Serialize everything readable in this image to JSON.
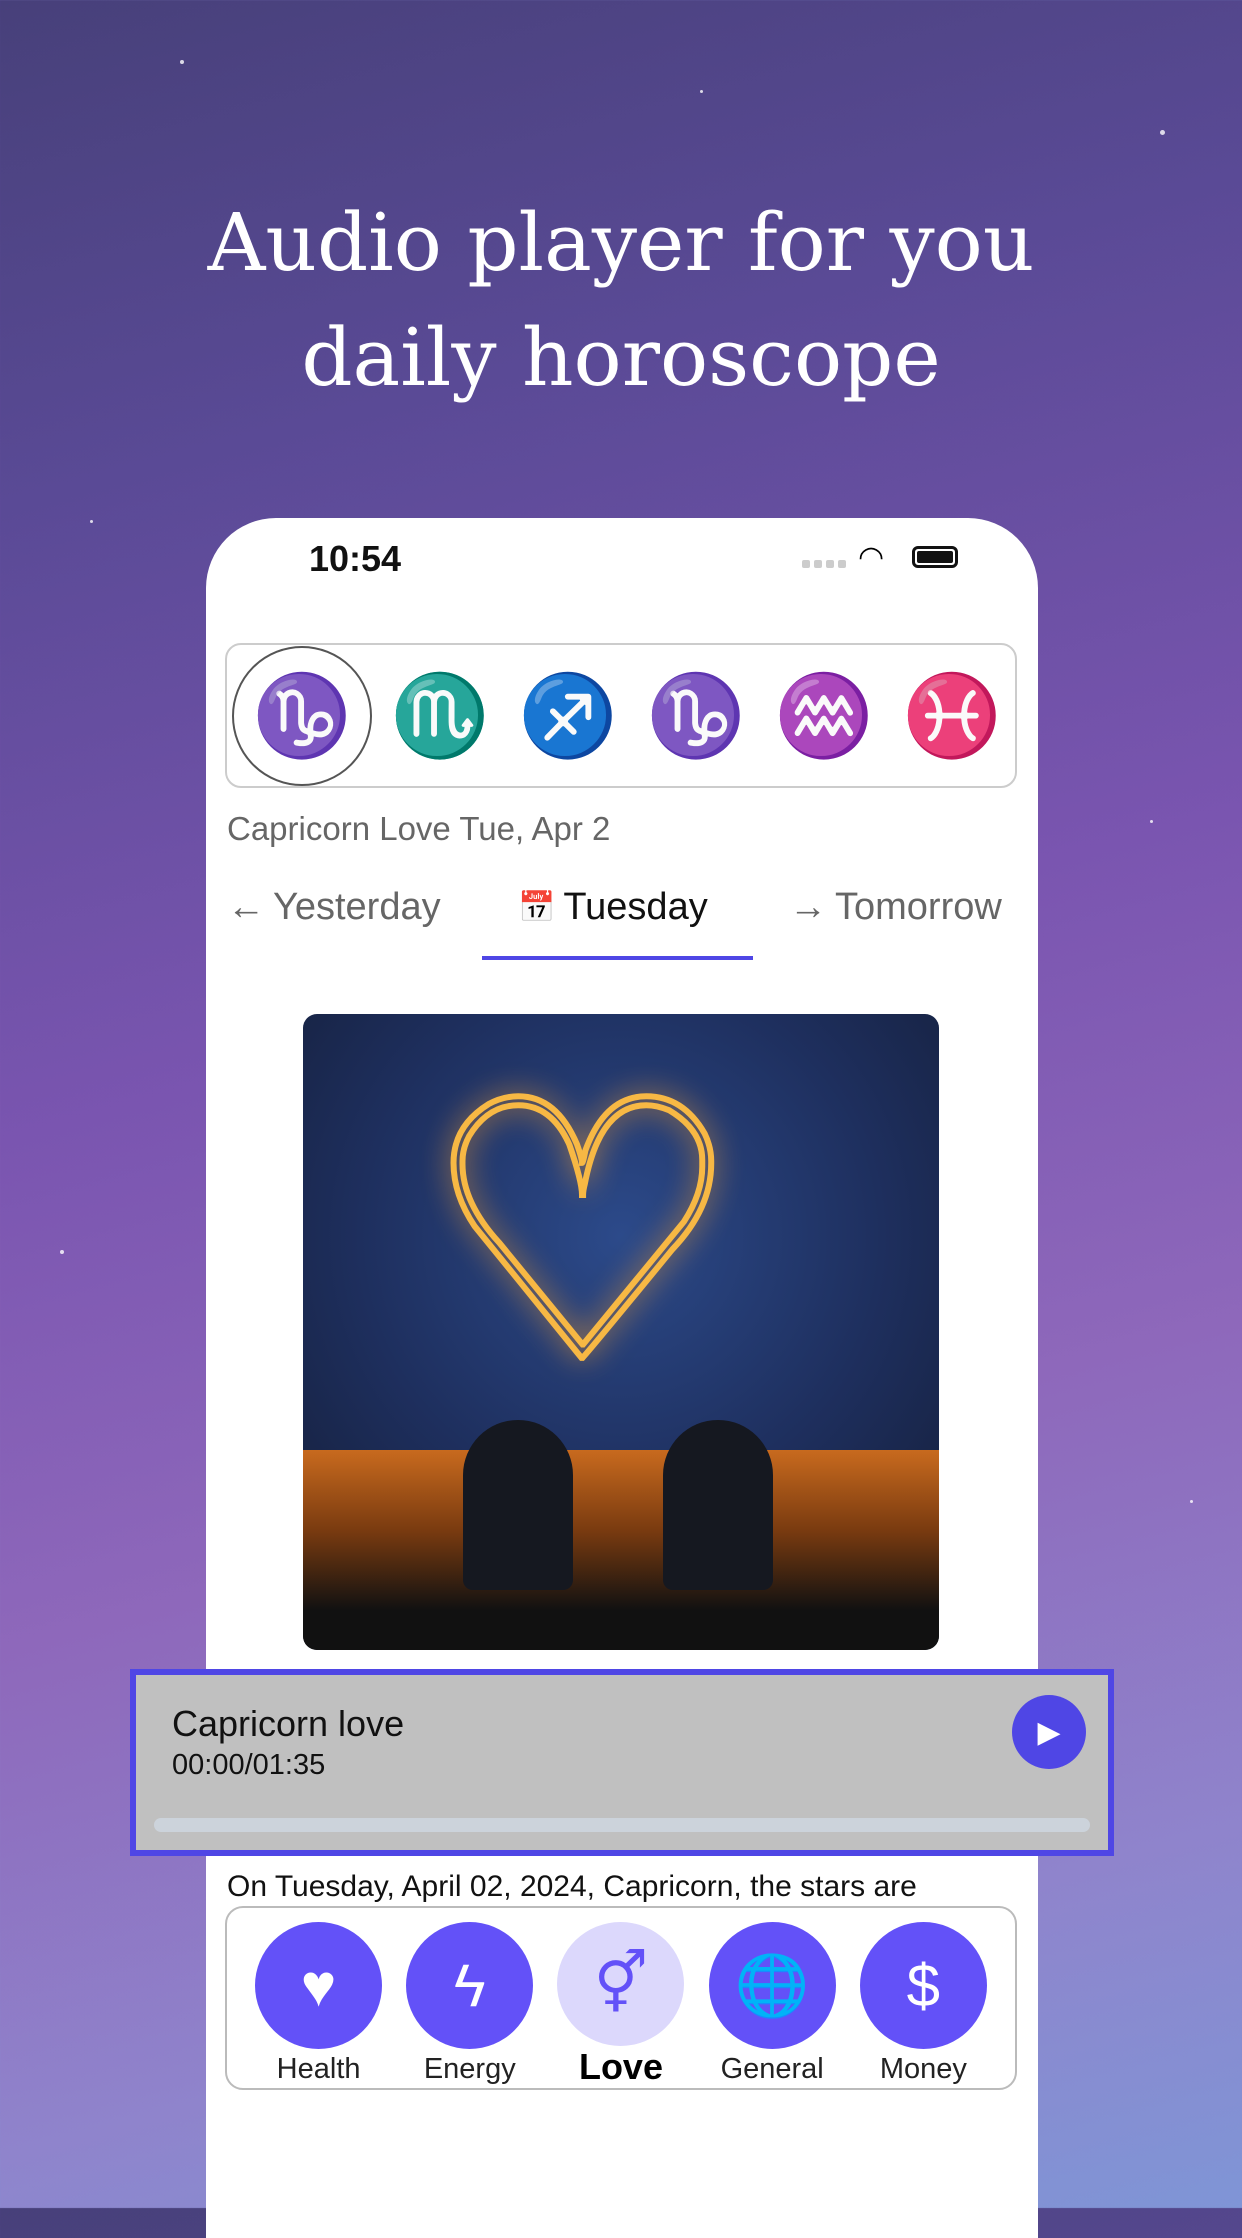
{
  "headline": {
    "line1": "Audio player for you",
    "line2": "daily horoscope"
  },
  "status_bar": {
    "time": "10:54"
  },
  "zodiac_strip": {
    "signs": [
      {
        "name": "capricorn",
        "glyph": "♑",
        "selected": true
      },
      {
        "name": "scorpio",
        "glyph": "♏"
      },
      {
        "name": "sagittarius",
        "glyph": "♐"
      },
      {
        "name": "capricorn",
        "glyph": "♑"
      },
      {
        "name": "aquarius",
        "glyph": "♒"
      },
      {
        "name": "pisces",
        "glyph": "♓"
      }
    ]
  },
  "caption": "Capricorn Love Tue, Apr 2",
  "tabs": [
    {
      "label": "Yesterday",
      "icon": "←"
    },
    {
      "label": "Tuesday",
      "icon": "📅",
      "active": true
    },
    {
      "label": "Tomorrow",
      "icon": "→"
    }
  ],
  "player": {
    "title": "Capricorn love",
    "time": "00:00/01:35",
    "progress": 0,
    "play_icon": "▶"
  },
  "description": "On Tuesday, April 02, 2024, Capricorn, the stars are",
  "categories": [
    {
      "label": "Health",
      "icon": "♥"
    },
    {
      "label": "Energy",
      "icon": "ϟ"
    },
    {
      "label": "Love",
      "icon": "⚥",
      "selected": true
    },
    {
      "label": "General",
      "icon": "🌐"
    },
    {
      "label": "Money",
      "icon": "$"
    }
  ],
  "colors": {
    "accent": "#4f46e5",
    "category": "#6351f8",
    "category_selected": "#dcd8fc",
    "player_bg": "#c0c0c0"
  }
}
